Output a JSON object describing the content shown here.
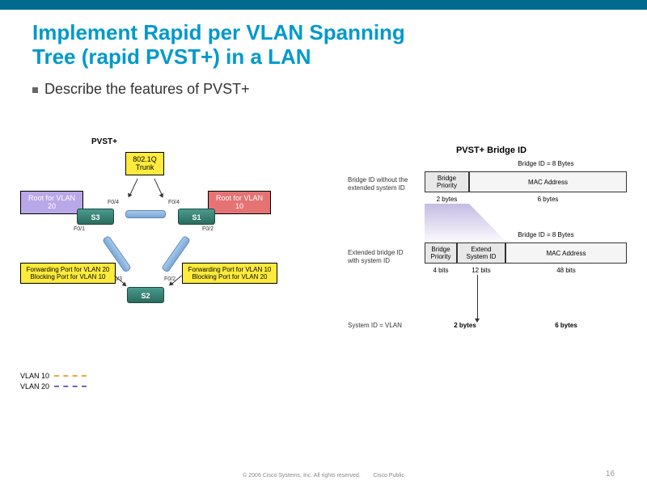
{
  "title_l1": "Implement Rapid per VLAN Spanning",
  "title_l2": "Tree (rapid PVST+) in a LAN",
  "bullet": "Describe the features of PVST+",
  "left_title": "PVST+",
  "trunk": "802.1Q\nTrunk",
  "root20": "Root for VLAN 20",
  "root10": "Root for VLAN 10",
  "fwd20": "Forwarding Port for VLAN 20\nBlocking Port for VLAN 10",
  "fwd10": "Forwarding Port for VLAN 10\nBlocking Port for VLAN 20",
  "s1": "S1",
  "s2": "S2",
  "s3": "S3",
  "p_f04": "F0/4",
  "p_f01": "F0/1",
  "p_f02": "F0/2",
  "p_f03": "F0/3",
  "vlan10": "VLAN 10",
  "vlan20": "VLAN 20",
  "right_title": "PVST+ Bridge ID",
  "bid8": "Bridge ID = 8 Bytes",
  "noext": "Bridge ID without the\nextended system ID",
  "ext": "Extended bridge ID\nwith system ID",
  "sysid": "System ID = VLAN",
  "bp": "Bridge\nPriority",
  "esi": "Extend\nSystem ID",
  "mac": "MAC Address",
  "b2": "2 bytes",
  "b6": "6 bytes",
  "bits4": "4 bits",
  "bits12": "12 bits",
  "bits48": "48 bits",
  "foot_c": "© 2006 Cisco Systems, Inc. All rights reserved.",
  "foot_p": "Cisco Public",
  "page": "16"
}
